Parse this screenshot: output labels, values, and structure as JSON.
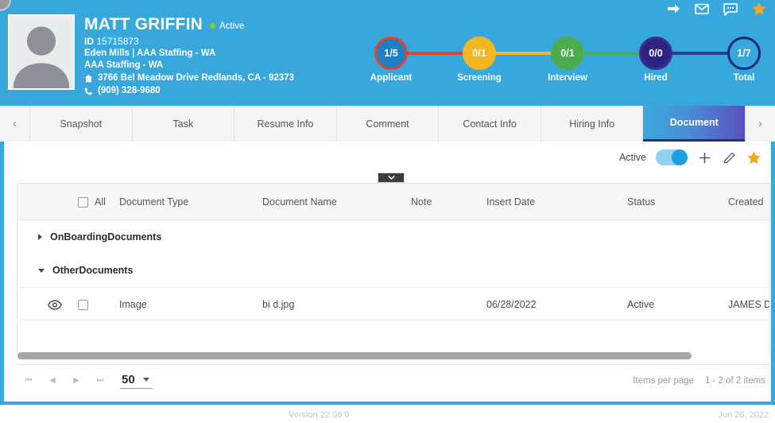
{
  "header": {
    "icons": [
      {
        "name": "share-arrow-icon",
        "label": "Share"
      },
      {
        "name": "mail-icon",
        "label": "Mail"
      },
      {
        "name": "chat-icon",
        "label": "Chat"
      },
      {
        "name": "star-icon",
        "label": "Favorite"
      }
    ],
    "accent_color": "#38a8dc",
    "star_color": "#f5a623"
  },
  "candidate": {
    "name": "MATT GRIFFIN",
    "status": "Active",
    "status_color": "#7ed321",
    "id_label": "ID",
    "id_value": "15715873",
    "branch": "Eden Mills | AAA Staffing - WA",
    "company": "AAA Staffing - WA",
    "address": "3766 Bel Meadow Drive Redlands, CA - 92373",
    "phone": "(909) 328-9680",
    "avatar_alt": "Candidate photo placeholder"
  },
  "pipeline": {
    "stages": [
      {
        "label": "Applicant",
        "value": "1/5",
        "ring": "#e8412e",
        "fill": "#1f7fc4",
        "line": "#e8412e"
      },
      {
        "label": "Screening",
        "value": "0/1",
        "ring": "#f5b721",
        "fill": "#f5b721",
        "line": "#f5b721"
      },
      {
        "label": "Interview",
        "value": "0/1",
        "ring": "#4cad50",
        "fill": "#4cad50",
        "line": "#4cad50"
      },
      {
        "label": "Hired",
        "value": "0/0",
        "ring": "#3b2f8f",
        "fill": "#2e2380",
        "line": "#2a3a96"
      },
      {
        "label": "Total",
        "value": "1/7",
        "ring": "#1b2a78",
        "fill": "#38a8dc",
        "line": "#1b2a78"
      }
    ]
  },
  "tabs": {
    "prev_icon": "chevron-left-icon",
    "next_icon": "chevron-right-icon",
    "items": [
      {
        "label": "Snapshot",
        "active": false
      },
      {
        "label": "Task",
        "active": false
      },
      {
        "label": "Resume Info",
        "active": false
      },
      {
        "label": "Comment",
        "active": false
      },
      {
        "label": "Contact Info",
        "active": false
      },
      {
        "label": "Hiring Info",
        "active": false
      },
      {
        "label": "Document",
        "active": true
      }
    ],
    "active_gradient_from": "#3ba7de",
    "active_gradient_to": "#5b4fc0"
  },
  "toolbar": {
    "active_label": "Active",
    "toggle_on": true,
    "add_label": "Add",
    "edit_label": "Edit",
    "favorite_label": "Favorite"
  },
  "grid": {
    "select_all_label": "All",
    "columns": [
      "Document Type",
      "Document Name",
      "Note",
      "Insert Date",
      "Status",
      "Created"
    ],
    "groups": [
      {
        "name": "OnBoardingDocuments",
        "expanded": false
      },
      {
        "name": "OtherDocuments",
        "expanded": true
      }
    ],
    "rows": [
      {
        "document_type": "Image",
        "document_name": "bi d.jpg",
        "note": "",
        "insert_date": "06/28/2022",
        "status": "Active",
        "created": "JAMES DO"
      }
    ]
  },
  "pager": {
    "first_icon": "page-first-icon",
    "prev_icon": "page-prev-icon",
    "next_icon": "page-next-icon",
    "last_icon": "page-last-icon",
    "page_size": "50",
    "items_per_page_label": "Items per page",
    "range_label": "1 - 2 of 2 items"
  },
  "statusbar": {
    "version": "Version 22.06.0",
    "date": "Jun 28, 2022"
  }
}
